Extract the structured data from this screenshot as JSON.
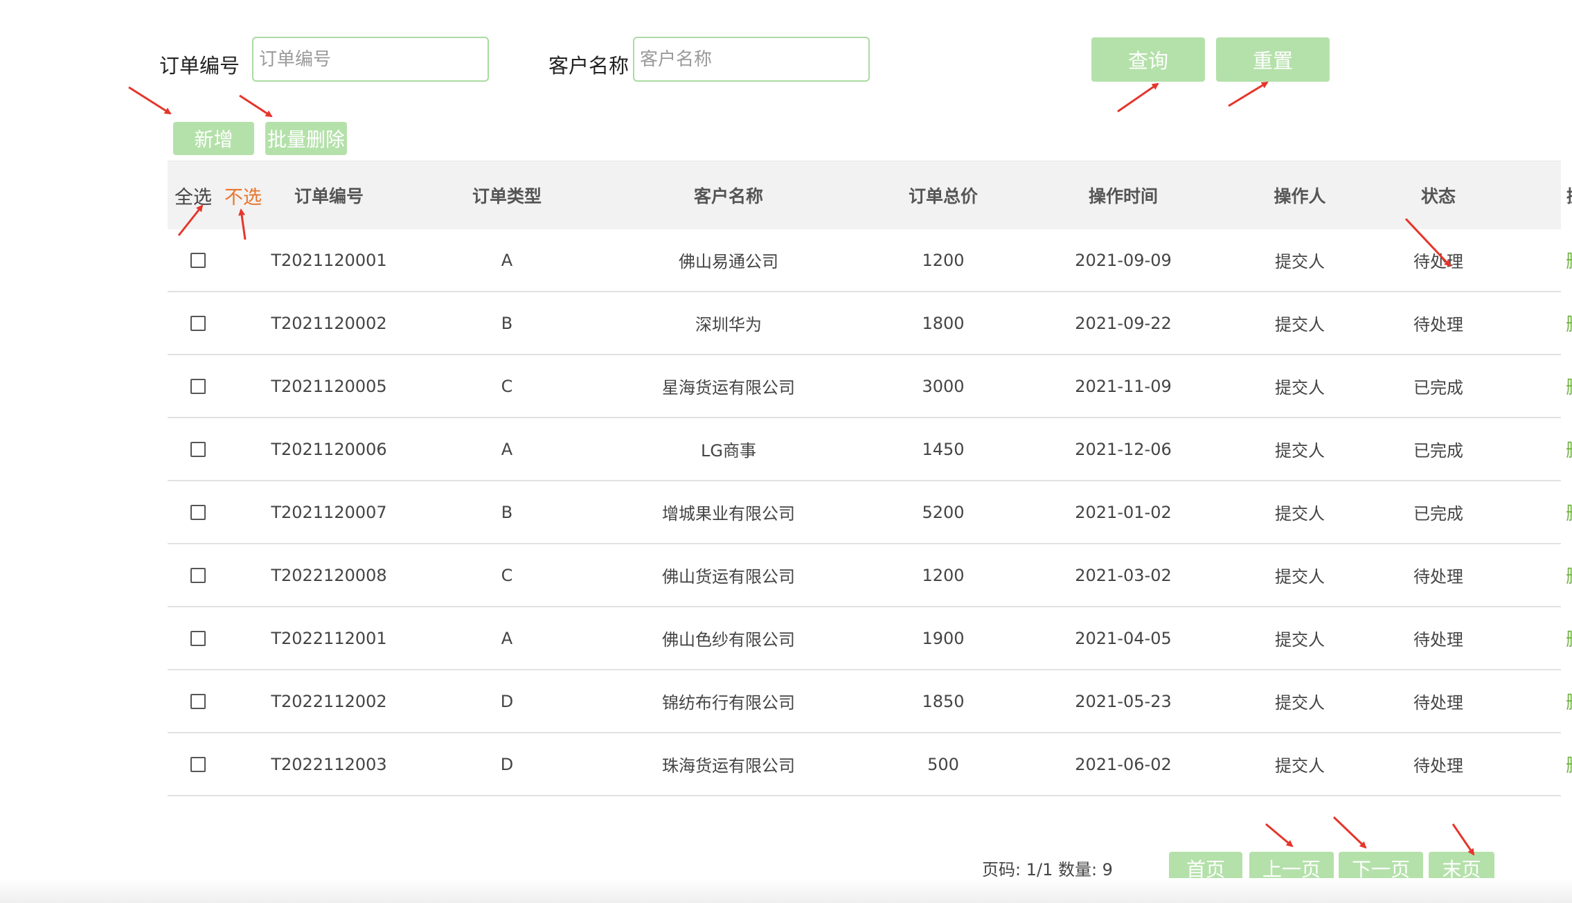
{
  "search": {
    "order_no_label": "订单编号",
    "order_no_placeholder": "订单编号",
    "order_no_value": "",
    "customer_label": "客户名称",
    "customer_placeholder": "客户名称",
    "customer_value": "",
    "query_label": "查询",
    "reset_label": "重置"
  },
  "toolbar": {
    "add_label": "新增",
    "batch_delete_label": "批量删除"
  },
  "table": {
    "select_all_label": "全选",
    "select_none_label": "不选",
    "columns": [
      "订单编号",
      "订单类型",
      "客户名称",
      "订单总价",
      "操作时间",
      "操作人",
      "状态",
      "操作"
    ],
    "delete_label": "删除",
    "rows": [
      {
        "order_no": "T2021120001",
        "type": "A",
        "customer": "佛山易通公司",
        "total": "1200",
        "time": "2021-09-09",
        "operator": "提交人",
        "status": "待处理"
      },
      {
        "order_no": "T2021120002",
        "type": "B",
        "customer": "深圳华为",
        "total": "1800",
        "time": "2021-09-22",
        "operator": "提交人",
        "status": "待处理"
      },
      {
        "order_no": "T2021120005",
        "type": "C",
        "customer": "星海货运有限公司",
        "total": "3000",
        "time": "2021-11-09",
        "operator": "提交人",
        "status": "已完成"
      },
      {
        "order_no": "T2021120006",
        "type": "A",
        "customer": "LG商事",
        "total": "1450",
        "time": "2021-12-06",
        "operator": "提交人",
        "status": "已完成"
      },
      {
        "order_no": "T2021120007",
        "type": "B",
        "customer": "增城果业有限公司",
        "total": "5200",
        "time": "2021-01-02",
        "operator": "提交人",
        "status": "已完成"
      },
      {
        "order_no": "T2022120008",
        "type": "C",
        "customer": "佛山货运有限公司",
        "total": "1200",
        "time": "2021-03-02",
        "operator": "提交人",
        "status": "待处理"
      },
      {
        "order_no": "T2022112001",
        "type": "A",
        "customer": "佛山色纱有限公司",
        "total": "1900",
        "time": "2021-04-05",
        "operator": "提交人",
        "status": "待处理"
      },
      {
        "order_no": "T2022112002",
        "type": "D",
        "customer": "锦纺布行有限公司",
        "total": "1850",
        "time": "2021-05-23",
        "operator": "提交人",
        "status": "待处理"
      },
      {
        "order_no": "T2022112003",
        "type": "D",
        "customer": "珠海货运有限公司",
        "total": "500",
        "time": "2021-06-02",
        "operator": "提交人",
        "status": "待处理"
      }
    ]
  },
  "pager": {
    "info": "页码: 1/1 数量: 9",
    "first_label": "首页",
    "prev_label": "上一页",
    "next_label": "下一页",
    "last_label": "末页"
  },
  "colors": {
    "button_bg": "#b4e1aa",
    "input_border": "#a9dba1",
    "delete_link": "#6fb33f",
    "select_none_text": "#e8752e",
    "annotation_arrow": "#e5362b"
  }
}
